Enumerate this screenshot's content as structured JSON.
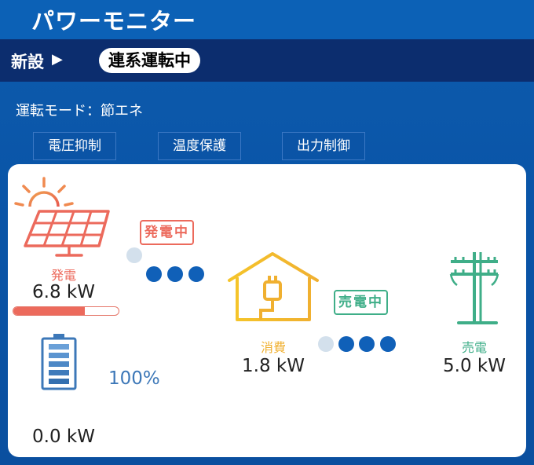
{
  "header": {
    "title": "パワーモニター"
  },
  "status": {
    "install_label": "新設",
    "arrow_glyph": "▶",
    "state_pill": "連系運転中"
  },
  "mode": {
    "text": "運転モード：節エネ"
  },
  "flags": [
    {
      "label": "電圧抑制"
    },
    {
      "label": "温度保護"
    },
    {
      "label": "出力制御"
    }
  ],
  "generation": {
    "label": "発電",
    "value": "6.8 kW",
    "status_tag": "発電中",
    "progress_fraction": 0.68,
    "color": "#ec6a5c"
  },
  "battery": {
    "charge_percent": "100%",
    "value": "0.0 kW",
    "color": "#3d78b8"
  },
  "consumption": {
    "label": "消費",
    "value": "1.8 kW",
    "color": "#f0c830"
  },
  "selling": {
    "label": "売電",
    "value": "5.0 kW",
    "status_tag": "売電中",
    "color": "#3fae88"
  },
  "flow_dots": {
    "active_color": "#1060b8",
    "inactive_color": "#d3e0ec"
  }
}
